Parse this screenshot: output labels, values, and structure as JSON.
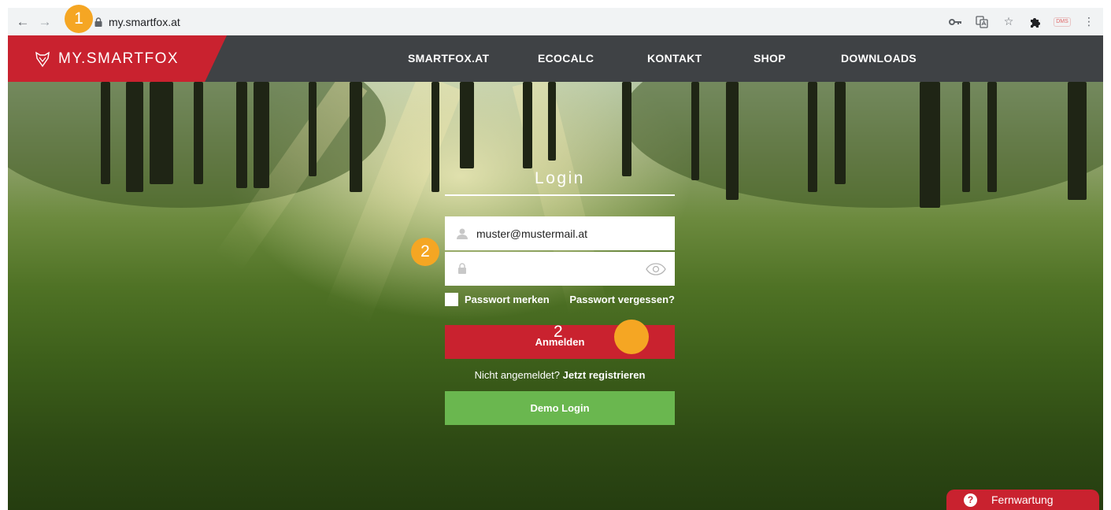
{
  "browser": {
    "url": "my.smartfox.at",
    "icons": [
      "back-icon",
      "forward-icon",
      "lock-icon",
      "key-icon",
      "translate-icon",
      "star-icon",
      "puzzle-icon",
      "dms-icon",
      "menu-icon"
    ],
    "dms_label": "DMS"
  },
  "header": {
    "logo_text": "MY.SMARTFOX",
    "nav": [
      "SMARTFOX.AT",
      "ECOCALC",
      "KONTAKT",
      "SHOP",
      "DOWNLOADS"
    ]
  },
  "login": {
    "title": "Login",
    "email_value": "muster@mustermail.at",
    "password_value": "",
    "remember_label": "Passwort merken",
    "forgot_label": "Passwort vergessen?",
    "submit_label": "Anmelden",
    "register_prompt": "Nicht angemeldet?",
    "register_link": "Jetzt registrieren",
    "demo_label": "Demo Login"
  },
  "annotations": {
    "marker_1": "1",
    "marker_2": "2",
    "marker_3": "2"
  },
  "help": {
    "label": "Fernwartung",
    "icon_glyph": "?"
  },
  "colors": {
    "brand_red": "#c9222f",
    "header_dark": "#3f4245",
    "demo_green": "#6ab74f",
    "marker_orange": "#f5a623"
  }
}
